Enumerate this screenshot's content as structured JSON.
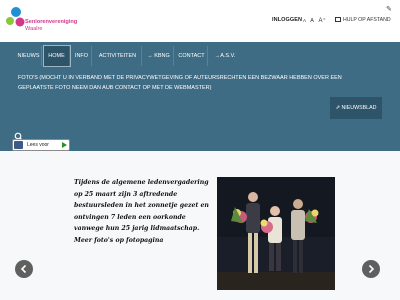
{
  "header": {
    "logo_line1": "Seniorenvereniging",
    "logo_line2": "Waalre",
    "login_label": "INLOGGEN",
    "font_small": "A",
    "font_medium": "A",
    "font_large": "A⁺",
    "help_label": "HULP OP AFSTAND"
  },
  "nav": {
    "items": [
      "NIEUWS",
      "HOME",
      "INFO",
      "ACTIVITEITEN",
      "→ KBNG",
      "CONTACT",
      "→A.S.V."
    ],
    "active": "HOME"
  },
  "banner": {
    "text": "FOTO'S (MOCHT U IN VERBAND MET DE PRIVACYWETGEVING OF AUTEURSRECHTEN EEN BEZWAAR HEBBEN OVER EEN GEPLAATSTE FOTO NEEM DAN AUB CONTACT OP MET DE WEBMASTER)",
    "newsletter_label": "NIEUWSBLAD"
  },
  "readspeaker": {
    "label": "Lees voor"
  },
  "slide": {
    "caption": "Tijdens de algemene ledenvergadering op 25 maart zijn 3 aftredende bestuursleden in het zonnetje gezet en ontvingen 7 leden een oorkonde vanwege hun 25 jarig lidmaatschap. Meer foto's op fotopagina"
  },
  "colors": {
    "nav_bg": "#3f6c85",
    "nav_active": "#2d5468",
    "brand_pink": "#d2378c",
    "brand_blue": "#1f8fd6",
    "brand_green": "#8cc63f"
  },
  "icons": {
    "search": "search-icon",
    "edit": "pen-icon",
    "help": "monitor-icon",
    "newsletter": "external-link-icon",
    "prev": "chevron-left-icon",
    "next": "chevron-right-icon"
  }
}
